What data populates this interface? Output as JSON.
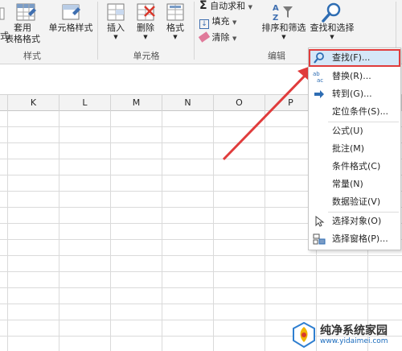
{
  "ribbon": {
    "styles_group": {
      "label": "样式",
      "partial_label": "式",
      "apply_table_line1": "套用",
      "apply_table_line2": "表格格式",
      "cell_styles": "单元格样式"
    },
    "cells_group": {
      "label": "单元格",
      "insert": "插入",
      "delete": "删除",
      "format": "格式"
    },
    "editing_group": {
      "label": "编辑",
      "autosum": "自动求和",
      "fill": "填充",
      "clear": "清除",
      "sort_filter": "排序和筛选",
      "find_select": "查找和选择"
    }
  },
  "columns": [
    "K",
    "L",
    "M",
    "N",
    "O",
    "P"
  ],
  "find_menu": {
    "items": [
      {
        "label": "查找(F)...",
        "icon": "magnifier-icon"
      },
      {
        "label": "替换(R)...",
        "icon": "replace-ab-icon"
      },
      {
        "label": "转到(G)...",
        "icon": "goto-arrow-icon"
      },
      {
        "label": "定位条件(S)...",
        "icon": ""
      },
      {
        "label": "公式(U)",
        "icon": ""
      },
      {
        "label": "批注(M)",
        "icon": ""
      },
      {
        "label": "条件格式(C)",
        "icon": ""
      },
      {
        "label": "常量(N)",
        "icon": ""
      },
      {
        "label": "数据验证(V)",
        "icon": ""
      },
      {
        "label": "选择对象(O)",
        "icon": "select-objects-icon"
      },
      {
        "label": "选择窗格(P)...",
        "icon": "selection-pane-icon"
      }
    ]
  },
  "watermark": {
    "title": "纯净系统家园",
    "url": "www.yidaimei.com"
  },
  "colors": {
    "annotation_red": "#e03c3c",
    "menu_highlight": "#d5e7f8",
    "ribbon_bg": "#f3f3f3"
  }
}
